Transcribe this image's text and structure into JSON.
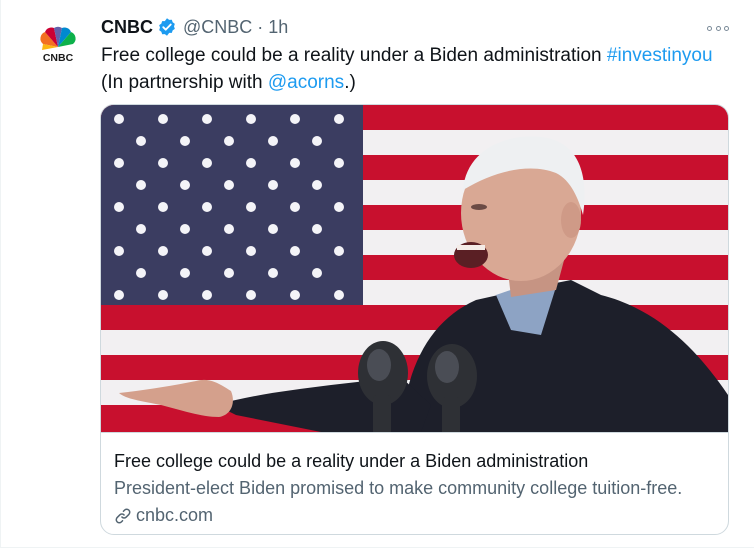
{
  "tweet": {
    "author": {
      "name": "CNBC",
      "handle": "@CNBC",
      "time": "1h",
      "avatar_icon": "cnbc-peacock-logo",
      "avatar_logo_text": "CNBC",
      "verified_icon": "verified-badge-icon"
    },
    "text_parts": {
      "before_hashtag": "Free college could be a reality under a Biden administration ",
      "hashtag": "#investinyou",
      "middle": " (In partnership with ",
      "mention": "@acorns",
      "after": ".)"
    },
    "more_icon": "more-options-icon",
    "card": {
      "image_description_icon": "flag-speaker-photo",
      "title": "Free college could be a reality under a Biden administration",
      "description": "President-elect Biden promised to make community college tuition-free.",
      "domain": "cnbc.com",
      "domain_icon": "link-icon"
    }
  },
  "colors": {
    "link": "#1d9bf0",
    "secondary_text": "#536471",
    "verified": "#1d9bf0",
    "border": "#cfd9de"
  }
}
